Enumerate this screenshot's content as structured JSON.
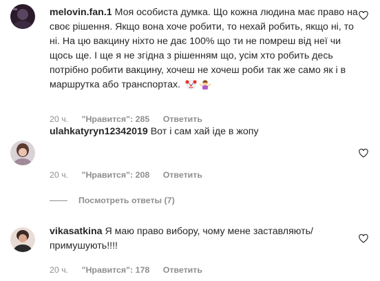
{
  "comments": [
    {
      "username": "melovin.fan.1",
      "text": "Моя особиста думка. Що кожна людина має право на своє рішення. Якщо вона хоче робити, то нехай робить, якщо ні, то ні. На цю вакцину ніхто не дає 100% що ти не помреш від неї чи щось ще. І ще я не згідна з рішенням що, усім хто робить десь потрібно робити вакцину, хочеш не хочеш роби так же само як і в маршрутка або транспортах.",
      "emojis": [
        "clown-face-emoji",
        "woman-shrugging-emoji"
      ],
      "time": "20 ч.",
      "likes": "\"Нравится\": 285",
      "reply": "Ответить"
    },
    {
      "username": "ulahkatyryn12342019",
      "text": "Вот і сам хай іде в жопу",
      "time": "20 ч.",
      "likes": "\"Нравится\": 208",
      "reply": "Ответить"
    },
    {
      "username": "vikasatkina",
      "text": "Я маю право вибору, чому мене заставляють/ примушують!!!!",
      "time": "20 ч.",
      "likes": "\"Нравится\": 178",
      "reply": "Ответить"
    }
  ],
  "replies_toggle": "Посмотреть ответы (7)",
  "icons": {
    "like": "heart-outline-icon"
  },
  "colors": {
    "text": "#262626",
    "meta": "#8e8e8e",
    "background": "#ffffff"
  }
}
